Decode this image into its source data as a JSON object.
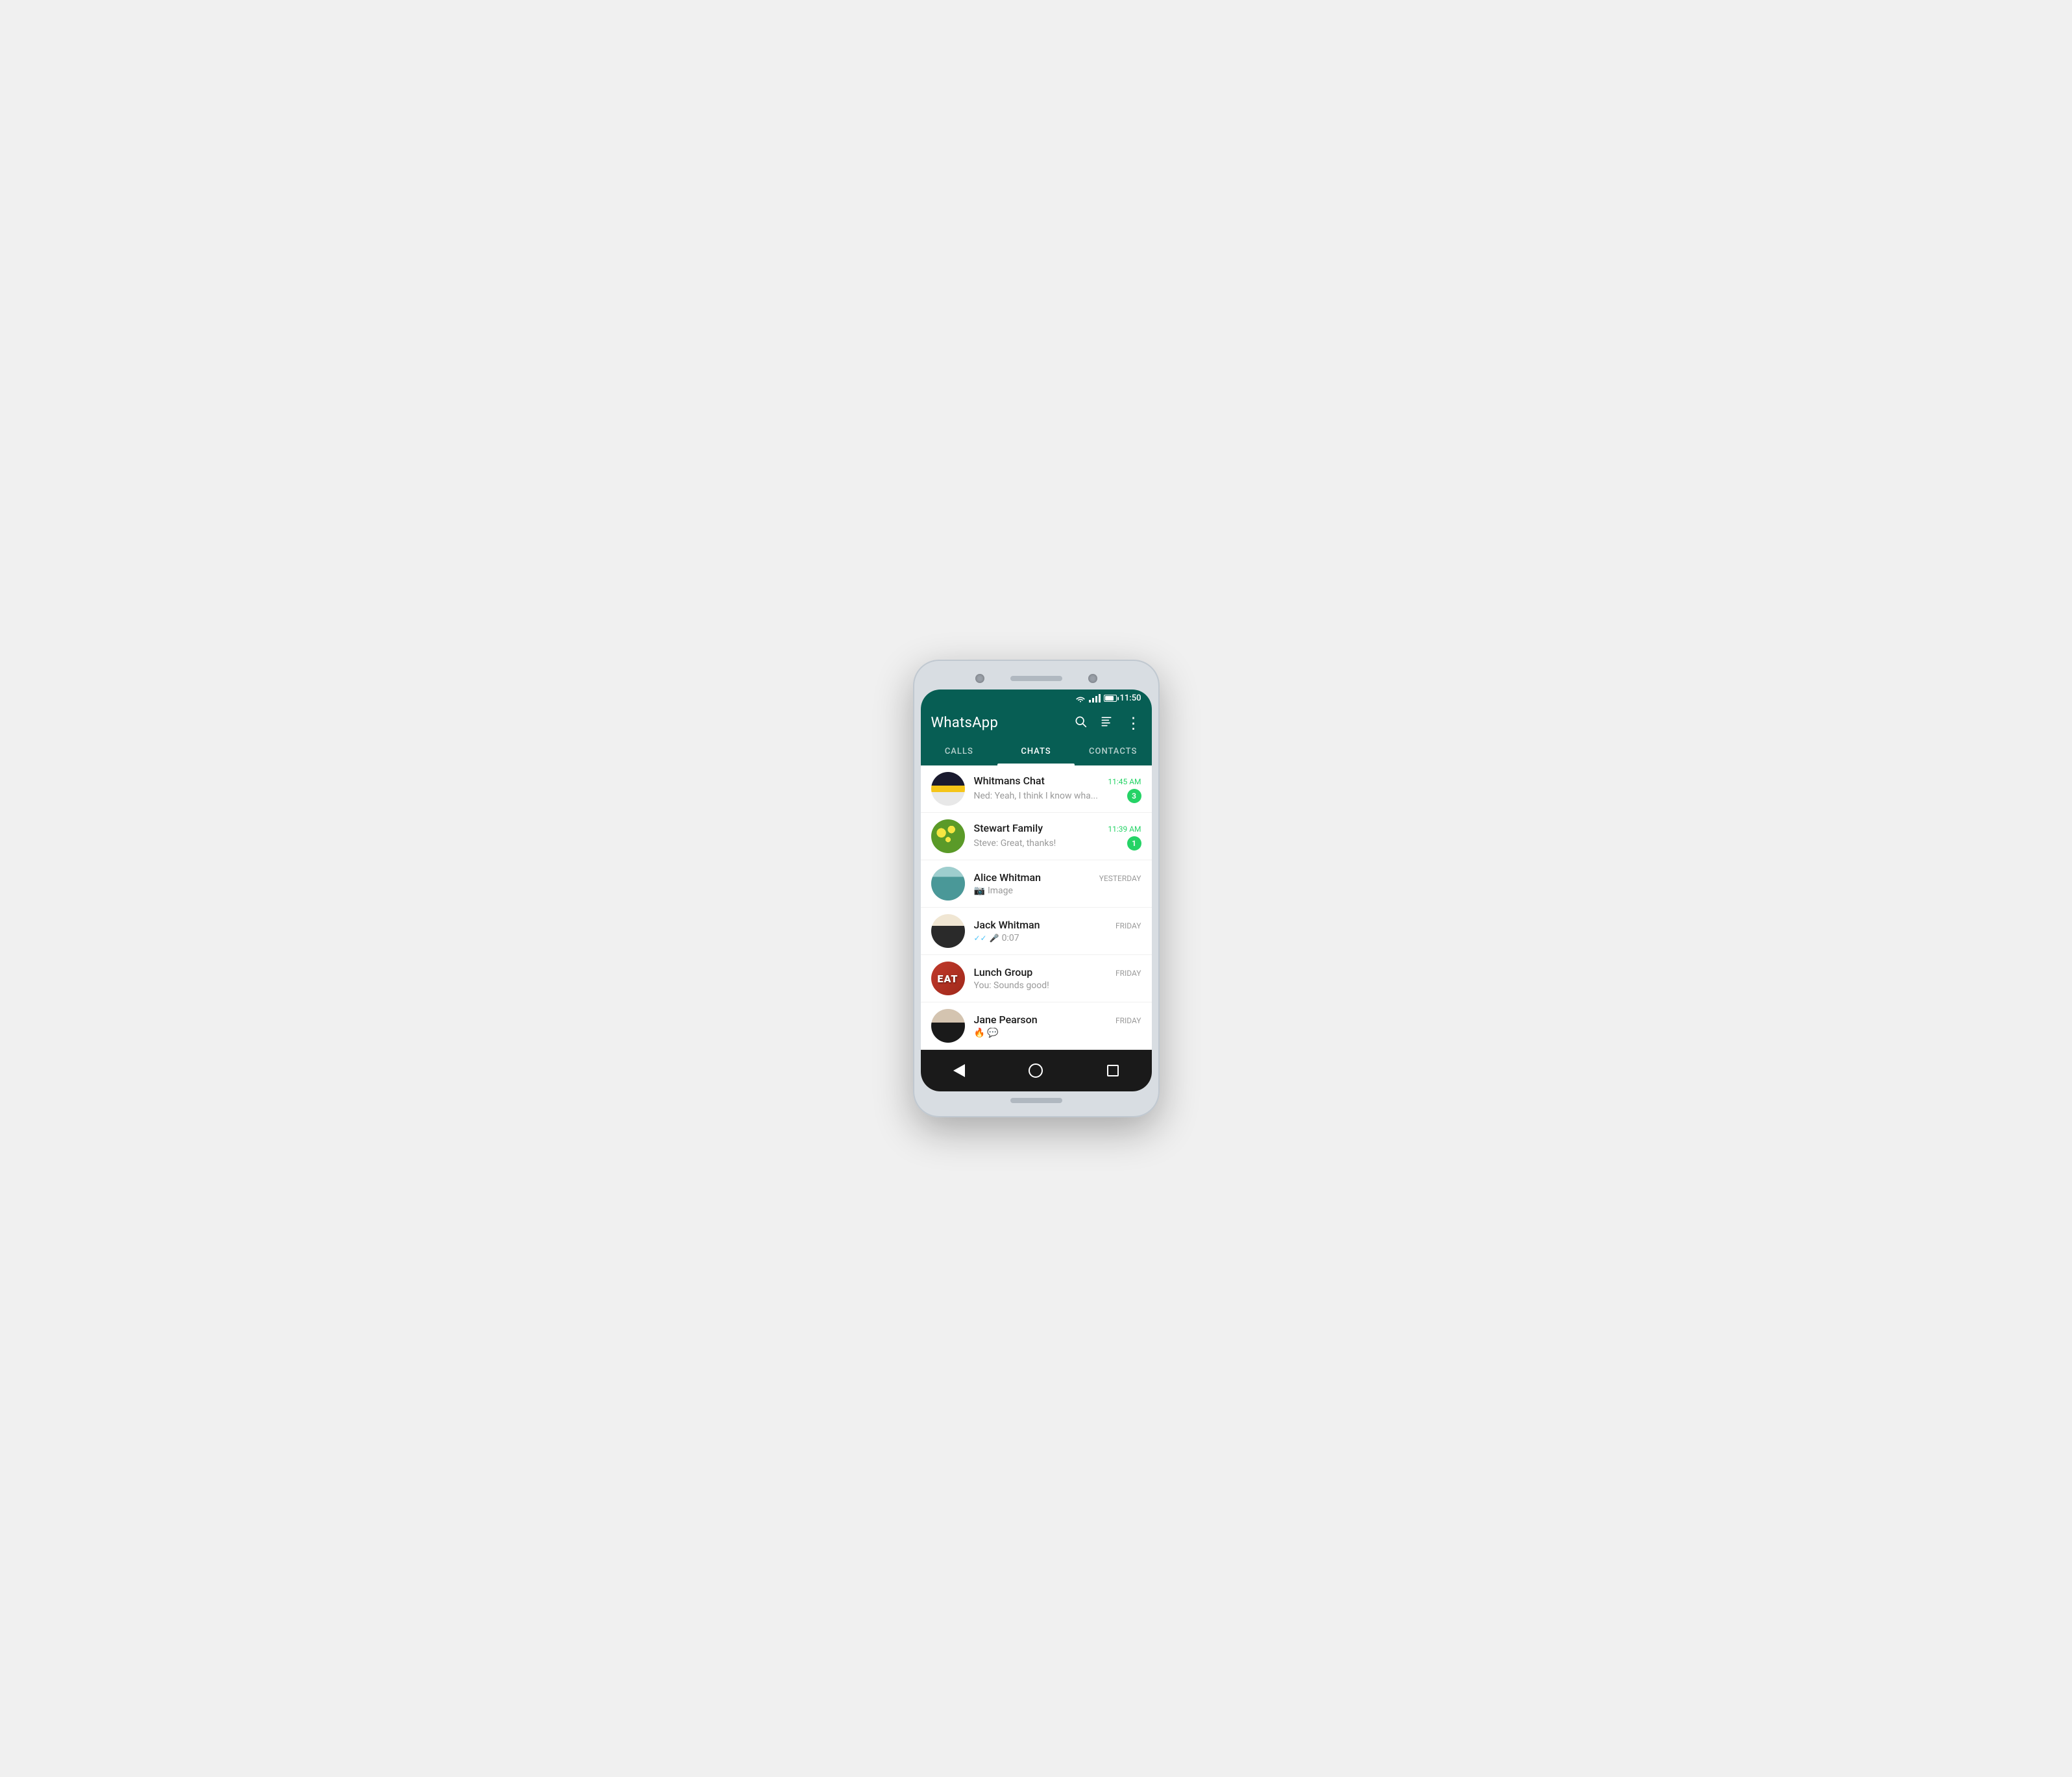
{
  "device": {
    "time": "11:50"
  },
  "app": {
    "title": "WhatsApp",
    "tabs": [
      {
        "id": "calls",
        "label": "CALLS",
        "active": false
      },
      {
        "id": "chats",
        "label": "CHATS",
        "active": true
      },
      {
        "id": "contacts",
        "label": "CONTACTS",
        "active": false
      }
    ],
    "header_icons": {
      "search": "🔍",
      "broadcast": "📋",
      "menu": "⋮"
    }
  },
  "chats": [
    {
      "id": "whitmans-chat",
      "name": "Whitmans Chat",
      "time": "11:45 AM",
      "time_unread": true,
      "preview": "Ned: Yeah, I think I know wha...",
      "unread_count": "3",
      "avatar_type": "whitmans"
    },
    {
      "id": "stewart-family",
      "name": "Stewart Family",
      "time": "11:39 AM",
      "time_unread": true,
      "preview": "Steve: Great, thanks!",
      "unread_count": "1",
      "avatar_type": "stewart"
    },
    {
      "id": "alice-whitman",
      "name": "Alice Whitman",
      "time": "YESTERDAY",
      "time_unread": false,
      "preview": "Image",
      "has_camera_icon": true,
      "unread_count": null,
      "avatar_type": "alice"
    },
    {
      "id": "jack-whitman",
      "name": "Jack Whitman",
      "time": "FRIDAY",
      "time_unread": false,
      "preview": "0:07",
      "has_mic_icon": true,
      "has_double_check": true,
      "unread_count": null,
      "avatar_type": "jack"
    },
    {
      "id": "lunch-group",
      "name": "Lunch Group",
      "time": "FRIDAY",
      "time_unread": false,
      "preview": "You: Sounds good!",
      "unread_count": null,
      "avatar_type": "lunch",
      "avatar_text": "EAT"
    },
    {
      "id": "jane-pearson",
      "name": "Jane Pearson",
      "time": "FRIDAY",
      "time_unread": false,
      "preview": "🔥 💬",
      "unread_count": null,
      "avatar_type": "jane"
    }
  ]
}
